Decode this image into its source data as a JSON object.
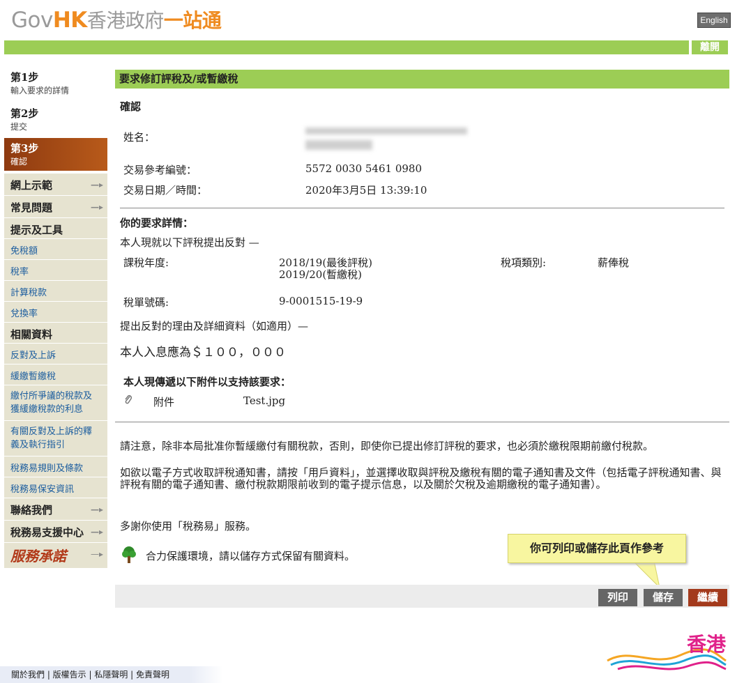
{
  "header": {
    "logo_gov": "Gov",
    "logo_hk": "HK",
    "logo_cn": "香港政府",
    "logo_cn2": "一站通",
    "lang_button": "English",
    "logout_button": "離開"
  },
  "sidebar": {
    "steps": [
      {
        "title": "第1步",
        "sub": "輸入要求的詳情"
      },
      {
        "title": "第2步",
        "sub": "提交"
      },
      {
        "title": "第3步",
        "sub": "確認"
      }
    ],
    "links": {
      "demo": "網上示範",
      "faq": "常見問題",
      "tips_head": "提示及工具",
      "allowance": "免稅額",
      "rates": "稅率",
      "calc": "計算稅款",
      "exchange": "兌換率",
      "related_head": "相關資料",
      "objection": "反對及上訴",
      "holdover": "緩繳暫繳稅",
      "dispute_l1": "繳付所爭議的稅款及",
      "dispute_l2": "獲緩繳稅款的利息",
      "guide_l1": "有關反對及上訴的釋",
      "guide_l2": "義及執行指引",
      "rules": "稅務易規則及條款",
      "security": "稅務易保安資訊",
      "contact": "聯絡我們",
      "support": "稅務易支援中心",
      "pledge": "服務承諾"
    }
  },
  "main": {
    "title": "要求修訂評稅及/或暫繳稅",
    "confirm_heading": "確認",
    "name_label": "姓名：",
    "txn_label": "交易參考編號：",
    "txn_value": "5572 0030 5461 0980",
    "date_label": "交易日期／時間：",
    "date_value": "2020年3月5日 13:39:10",
    "details_heading": "你的要求詳情：",
    "objection_intro": "本人現就以下評稅提出反對 —",
    "year_label": "課稅年度:",
    "year_value_1": "2018/19(最後評稅)",
    "year_value_2": "2019/20(暫繳稅)",
    "tax_type_label": "稅項類別:",
    "tax_type_value": "薪俸稅",
    "notice_label": "稅單號碼:",
    "notice_value": "9-0001515-19-9",
    "reason_label": "提出反對的理由及詳細資料（如適用）—",
    "reason_value": "本人入息應為＄１００，０００",
    "attach_heading": "本人現傳遞以下附件以支持該要求：",
    "attach_label": "附件",
    "attach_file": "Test.jpg",
    "note1": "請注意，除非本局批准你暫緩繳付有關稅款，否則，即使你已提出修訂評稅的要求，也必須於繳稅限期前繳付稅款。",
    "note2": "如欲以電子方式收取評稅通知書，請按「用戶資料」，並選擇收取與評稅及繳稅有關的電子通知書及文件（包括電子評稅通知書、與評稅有關的電子通知書、繳付稅款期限前收到的電子提示信息，以及關於欠稅及逾期繳稅的電子通知書）。",
    "thanks": "多謝你使用「稅務易」服務。",
    "eco": "合力保護環境，請以儲存方式保留有關資料。",
    "tooltip": "你可列印或儲存此頁作參考"
  },
  "actions": {
    "print": "列印",
    "save": "儲存",
    "continue": "繼續"
  },
  "footer": {
    "text": "關於我們 | 版權告示 | 私隱聲明 | 免責聲明",
    "brand": "香港"
  },
  "colors": {
    "green_bar": "#9ccd55",
    "active_step": "#a0481a",
    "sidebar_bg": "#e6e3d0",
    "continue_btn": "#a33a1c",
    "grey_btn": "#666666"
  }
}
